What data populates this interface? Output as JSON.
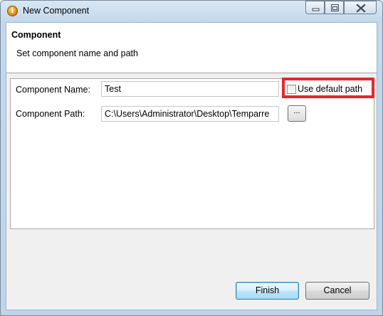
{
  "window": {
    "title": "New Component",
    "icon": "info-icon",
    "controls": [
      "minimize-icon",
      "restore-icon",
      "close-icon"
    ]
  },
  "header": {
    "title": "Component",
    "description": "Set component name and path"
  },
  "form": {
    "name_label": "Component Name:",
    "name_value": "Test",
    "default_path_label": "Use default path",
    "default_path_checked": false,
    "path_label": "Component Path:",
    "path_value": "C:\\Users\\Administrator\\Desktop\\Temparre",
    "browse_label": "..."
  },
  "buttons": {
    "finish": "Finish",
    "cancel": "Cancel"
  },
  "colors": {
    "highlight": "#e8262a",
    "default_button": "#3c7fb1"
  }
}
